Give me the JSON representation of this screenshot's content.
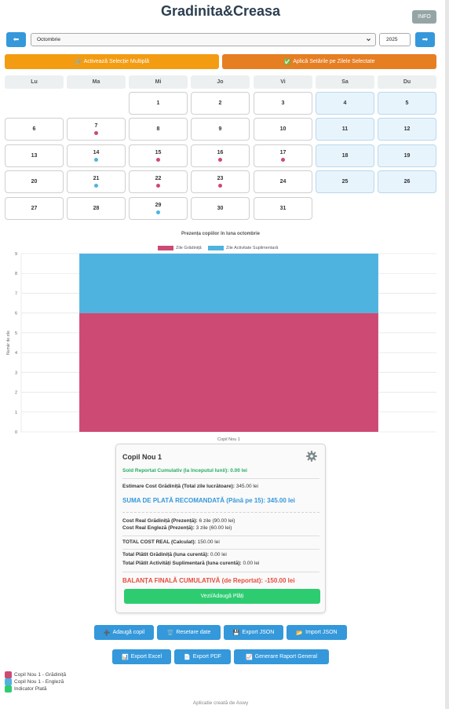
{
  "app": {
    "title": "Gradinita&Creasa",
    "info_label": "INFO"
  },
  "nav": {
    "prev_icon": "⬅",
    "next_icon": "➡",
    "month_value": "Octombrie",
    "year_value": "2025"
  },
  "actions": {
    "multi_select_icon": "🔗",
    "multi_select_label": "Activează Selecție Multiplă",
    "apply_icon": "✅",
    "apply_label": "Aplică Setările pe Zilele Selectate"
  },
  "calendar": {
    "weekdays": [
      "Lu",
      "Ma",
      "Mi",
      "Jo",
      "Vi",
      "Sa",
      "Du"
    ],
    "days": [
      {
        "n": "1",
        "dot": ""
      },
      {
        "n": "2",
        "dot": ""
      },
      {
        "n": "3",
        "dot": ""
      },
      {
        "n": "4",
        "dot": ""
      },
      {
        "n": "5",
        "dot": ""
      },
      {
        "n": "6",
        "dot": ""
      },
      {
        "n": "7",
        "dot": "gradinita"
      },
      {
        "n": "8",
        "dot": ""
      },
      {
        "n": "9",
        "dot": ""
      },
      {
        "n": "10",
        "dot": ""
      },
      {
        "n": "11",
        "dot": ""
      },
      {
        "n": "12",
        "dot": ""
      },
      {
        "n": "13",
        "dot": ""
      },
      {
        "n": "14",
        "dot": "engleza"
      },
      {
        "n": "15",
        "dot": "gradinita"
      },
      {
        "n": "16",
        "dot": "gradinita"
      },
      {
        "n": "17",
        "dot": "gradinita"
      },
      {
        "n": "18",
        "dot": ""
      },
      {
        "n": "19",
        "dot": ""
      },
      {
        "n": "20",
        "dot": ""
      },
      {
        "n": "21",
        "dot": "engleza"
      },
      {
        "n": "22",
        "dot": "gradinita"
      },
      {
        "n": "23",
        "dot": "gradinita"
      },
      {
        "n": "24",
        "dot": ""
      },
      {
        "n": "25",
        "dot": ""
      },
      {
        "n": "26",
        "dot": ""
      },
      {
        "n": "27",
        "dot": ""
      },
      {
        "n": "28",
        "dot": ""
      },
      {
        "n": "29",
        "dot": "engleza"
      },
      {
        "n": "30",
        "dot": ""
      },
      {
        "n": "31",
        "dot": ""
      }
    ],
    "first_weekday_index": 2
  },
  "colors": {
    "gradinita": "#cc4a74",
    "engleza": "#4fb3e0",
    "plata": "#2ecc71",
    "primary": "#3498db"
  },
  "chart_data": {
    "type": "bar",
    "stacked": true,
    "title": "Prezența copiilor în luna octombrie",
    "categories": [
      "Copil Nou 1"
    ],
    "series": [
      {
        "name": "Zile Grădiniță",
        "values": [
          6
        ],
        "color": "#cc4a74"
      },
      {
        "name": "Zile Activitate Suplimentară",
        "values": [
          3
        ],
        "color": "#4fb3e0"
      }
    ],
    "ylabel": "Număr de zile",
    "xlabel": "",
    "ylim": [
      0,
      9
    ],
    "yticks": [
      "0",
      "1",
      "2",
      "3",
      "4",
      "5",
      "6",
      "7",
      "8",
      "9"
    ],
    "grid": true,
    "legend_position": "top"
  },
  "card": {
    "child_name": "Copil Nou 1",
    "sold_reportat": "Sold Reportat Cumulativ (la începutul lunii): 0.00 lei",
    "estimare_label": "Estimare Cost Grădiniță (Total zile lucrătoare):",
    "estimare_value": "345.00 lei",
    "suma_recomandata": "SUMA DE PLATĂ RECOMANDATĂ (Până pe 15): 345.00 lei",
    "cost_gradinita_label": "Cost Real Grădiniță (Prezență):",
    "cost_gradinita_value": "6 zile (90.00 lei)",
    "cost_engleza_label": "Cost Real Engleză (Prezență):",
    "cost_engleza_value": "3 zile (60.00 lei)",
    "total_cost_label": "TOTAL COST REAL (Calculat):",
    "total_cost_value": "150.00 lei",
    "platit_gradinita_label": "Total Plătit Grădiniță (luna curentă):",
    "platit_gradinita_value": "0.00 lei",
    "platit_activitati_label": "Total Plătit Activități Suplimentară (luna curentă):",
    "platit_activitati_value": "0.00 lei",
    "balanta": "BALANȚA FINALĂ CUMULATIVĂ (de Reportat): -150.00 lei",
    "payments_button": "Vezi/Adaugă Plăți"
  },
  "buttons": {
    "add_child": {
      "icon": "➕",
      "label": "Adaugă copil"
    },
    "reset": {
      "icon": "🗑️",
      "label": "Resetare date"
    },
    "export_json": {
      "icon": "💾",
      "label": "Export JSON"
    },
    "import_json": {
      "icon": "📂",
      "label": "Import JSON"
    },
    "export_excel": {
      "icon": "📊",
      "label": "Export Excel"
    },
    "export_pdf": {
      "icon": "📄",
      "label": "Export PDF"
    },
    "report": {
      "icon": "📈",
      "label": "Generare Raport General"
    }
  },
  "bottom_legend": [
    {
      "label": "Copil Nou 1 - Grădiniță",
      "color": "#cc4a74"
    },
    {
      "label": "Copil Nou 1 - Engleză",
      "color": "#4fb3e0"
    },
    {
      "label": "Indicator Plată",
      "color": "#2ecc71"
    }
  ],
  "footer": "Aplicatie creată de Aswy"
}
